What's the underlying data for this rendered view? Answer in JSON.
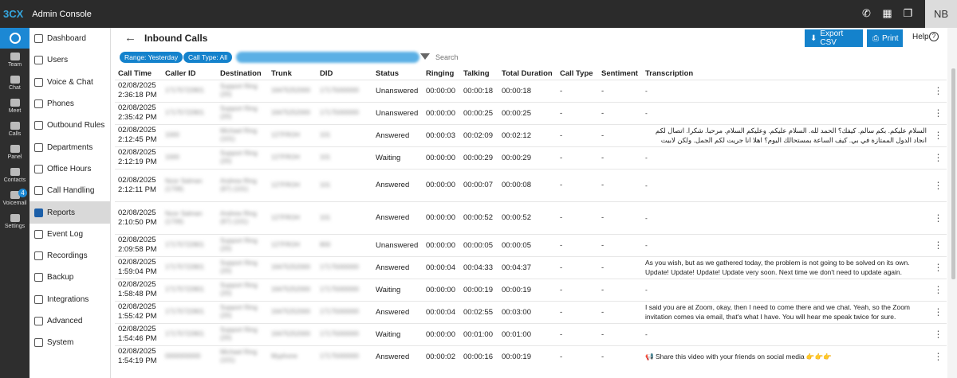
{
  "app": {
    "logo": "3CX",
    "title": "Admin Console",
    "avatar": "NB"
  },
  "topicons": [
    "phone-icon",
    "qr-icon",
    "book-icon"
  ],
  "rail": [
    {
      "label": "Team"
    },
    {
      "label": "Chat"
    },
    {
      "label": "Meet"
    },
    {
      "label": "Calls"
    },
    {
      "label": "Panel"
    },
    {
      "label": "Contacts"
    },
    {
      "label": "Voicemail",
      "badge": "4"
    },
    {
      "label": "Settings"
    }
  ],
  "sidebar": {
    "items": [
      {
        "label": "Dashboard"
      },
      {
        "label": "Users"
      },
      {
        "label": "Voice & Chat"
      },
      {
        "label": "Phones"
      },
      {
        "label": "Outbound Rules"
      },
      {
        "label": "Departments"
      },
      {
        "label": "Office Hours"
      },
      {
        "label": "Call Handling"
      },
      {
        "label": "Reports",
        "active": true
      },
      {
        "label": "Event Log"
      },
      {
        "label": "Recordings"
      },
      {
        "label": "Backup"
      },
      {
        "label": "Integrations"
      },
      {
        "label": "Advanced"
      },
      {
        "label": "System"
      }
    ]
  },
  "header": {
    "title": "Inbound Calls",
    "export_label": "Export CSV",
    "print_label": "Print",
    "help_label": "Help"
  },
  "filters": {
    "range": "Range: Yesterday",
    "type": "Call Type: All",
    "search_placeholder": "Search"
  },
  "table": {
    "columns": [
      "Call Time",
      "Caller ID",
      "Destination",
      "Trunk",
      "DID",
      "Status",
      "Ringing",
      "Talking",
      "Total Duration",
      "Call Type",
      "Sentiment",
      "Transcription"
    ],
    "rows": [
      {
        "date": "02/08/2025",
        "time": "2:36:18 PM",
        "caller": "17175722801",
        "dest": "Support Ring (20)",
        "trunk": "16475252000",
        "did": "17175000000",
        "status": "Unanswered",
        "ringing": "00:00:00",
        "talking": "00:00:18",
        "total": "00:00:18",
        "ctype": "-",
        "sent": "-",
        "trans": "-"
      },
      {
        "date": "02/08/2025",
        "time": "2:35:42 PM",
        "caller": "17175722801",
        "dest": "Support Ring (20)",
        "trunk": "16475252000",
        "did": "17175000000",
        "status": "Unanswered",
        "ringing": "00:00:00",
        "talking": "00:00:25",
        "total": "00:00:25",
        "ctype": "-",
        "sent": "-",
        "trans": "-"
      },
      {
        "date": "02/08/2025",
        "time": "2:12:45 PM",
        "caller": "1000",
        "dest": "Michael Ring (101)",
        "trunk": "127FROH",
        "did": "101",
        "status": "Answered",
        "ringing": "00:00:03",
        "talking": "00:02:09",
        "total": "00:02:12",
        "ctype": "-",
        "sent": "-",
        "trans": "السلام عليكم. بكم سالم. كيفك؟ الحمد لله. السلام عليكم. وعليكم السلام. مرحبا. شكرا. اتصال لكم انجاد الدول الممتازة في بي. كيف الساعة بمستحالك اليوم؟ اهلا انا جريت لكم الجمل. ولكن لابيت مكان الاستقبال. اهلا ليجيت مشتهد اعرب."
      },
      {
        "date": "02/08/2025",
        "time": "2:12:19 PM",
        "caller": "1000",
        "dest": "Support Ring (20)",
        "trunk": "127FROH",
        "did": "101",
        "status": "Waiting",
        "ringing": "00:00:00",
        "talking": "00:00:29",
        "total": "00:00:29",
        "ctype": "-",
        "sent": "-",
        "trans": "-"
      },
      {
        "date": "02/08/2025",
        "time": "2:12:11 PM",
        "caller": "Noor Salman (1706)",
        "dest": "Andrew Ring (97) (101)",
        "trunk": "127FROH",
        "did": "101",
        "status": "Answered",
        "ringing": "00:00:00",
        "talking": "00:00:07",
        "total": "00:00:08",
        "ctype": "-",
        "sent": "-",
        "trans": "-"
      },
      {
        "date": "02/08/2025",
        "time": "2:10:50 PM",
        "caller": "Noor Salman (1706)",
        "dest": "Andrew Ring (97) (101)",
        "trunk": "127FROH",
        "did": "101",
        "status": "Answered",
        "ringing": "00:00:00",
        "talking": "00:00:52",
        "total": "00:00:52",
        "ctype": "-",
        "sent": "-",
        "trans": "-"
      },
      {
        "date": "02/08/2025",
        "time": "2:09:58 PM",
        "caller": "17175722801",
        "dest": "Support Ring (20)",
        "trunk": "127FROH",
        "did": "800",
        "status": "Unanswered",
        "ringing": "00:00:00",
        "talking": "00:00:05",
        "total": "00:00:05",
        "ctype": "-",
        "sent": "-",
        "trans": "-"
      },
      {
        "date": "02/08/2025",
        "time": "1:59:04 PM",
        "caller": "17175722801",
        "dest": "Support Ring (20)",
        "trunk": "16475252000",
        "did": "17175000000",
        "status": "Answered",
        "ringing": "00:00:04",
        "talking": "00:04:33",
        "total": "00:04:37",
        "ctype": "-",
        "sent": "-",
        "trans": "As you wish, but as we gathered today, the problem is not going to be solved on its own. Update! Update! Update! Update very soon. Next time we don't need to update again."
      },
      {
        "date": "02/08/2025",
        "time": "1:58:48 PM",
        "caller": "17175722801",
        "dest": "Support Ring (20)",
        "trunk": "16475252000",
        "did": "17175000000",
        "status": "Waiting",
        "ringing": "00:00:00",
        "talking": "00:00:19",
        "total": "00:00:19",
        "ctype": "-",
        "sent": "-",
        "trans": "-"
      },
      {
        "date": "02/08/2025",
        "time": "1:55:42 PM",
        "caller": "17175722801",
        "dest": "Support Ring (20)",
        "trunk": "16475252000",
        "did": "17175000000",
        "status": "Answered",
        "ringing": "00:00:04",
        "talking": "00:02:55",
        "total": "00:03:00",
        "ctype": "-",
        "sent": "-",
        "trans": "I said you are at Zoom, okay, then I need to come there and we chat. Yeah, so the Zoom invitation comes via email, that's what I have. You will hear me speak twice for sure."
      },
      {
        "date": "02/08/2025",
        "time": "1:54:46 PM",
        "caller": "17175722801",
        "dest": "Support Ring (20)",
        "trunk": "16475252000",
        "did": "17175000000",
        "status": "Waiting",
        "ringing": "00:00:00",
        "talking": "00:01:00",
        "total": "00:01:00",
        "ctype": "-",
        "sent": "-",
        "trans": "-"
      },
      {
        "date": "02/08/2025",
        "time": "1:54:19 PM",
        "caller": "0000000000",
        "dest": "Michael Ring (101)",
        "trunk": "Myphone",
        "did": "17175000000",
        "status": "Answered",
        "ringing": "00:00:02",
        "talking": "00:00:16",
        "total": "00:00:19",
        "ctype": "-",
        "sent": "-",
        "trans": "📢 Share this video with your friends on social media 👉👉👉"
      }
    ]
  }
}
